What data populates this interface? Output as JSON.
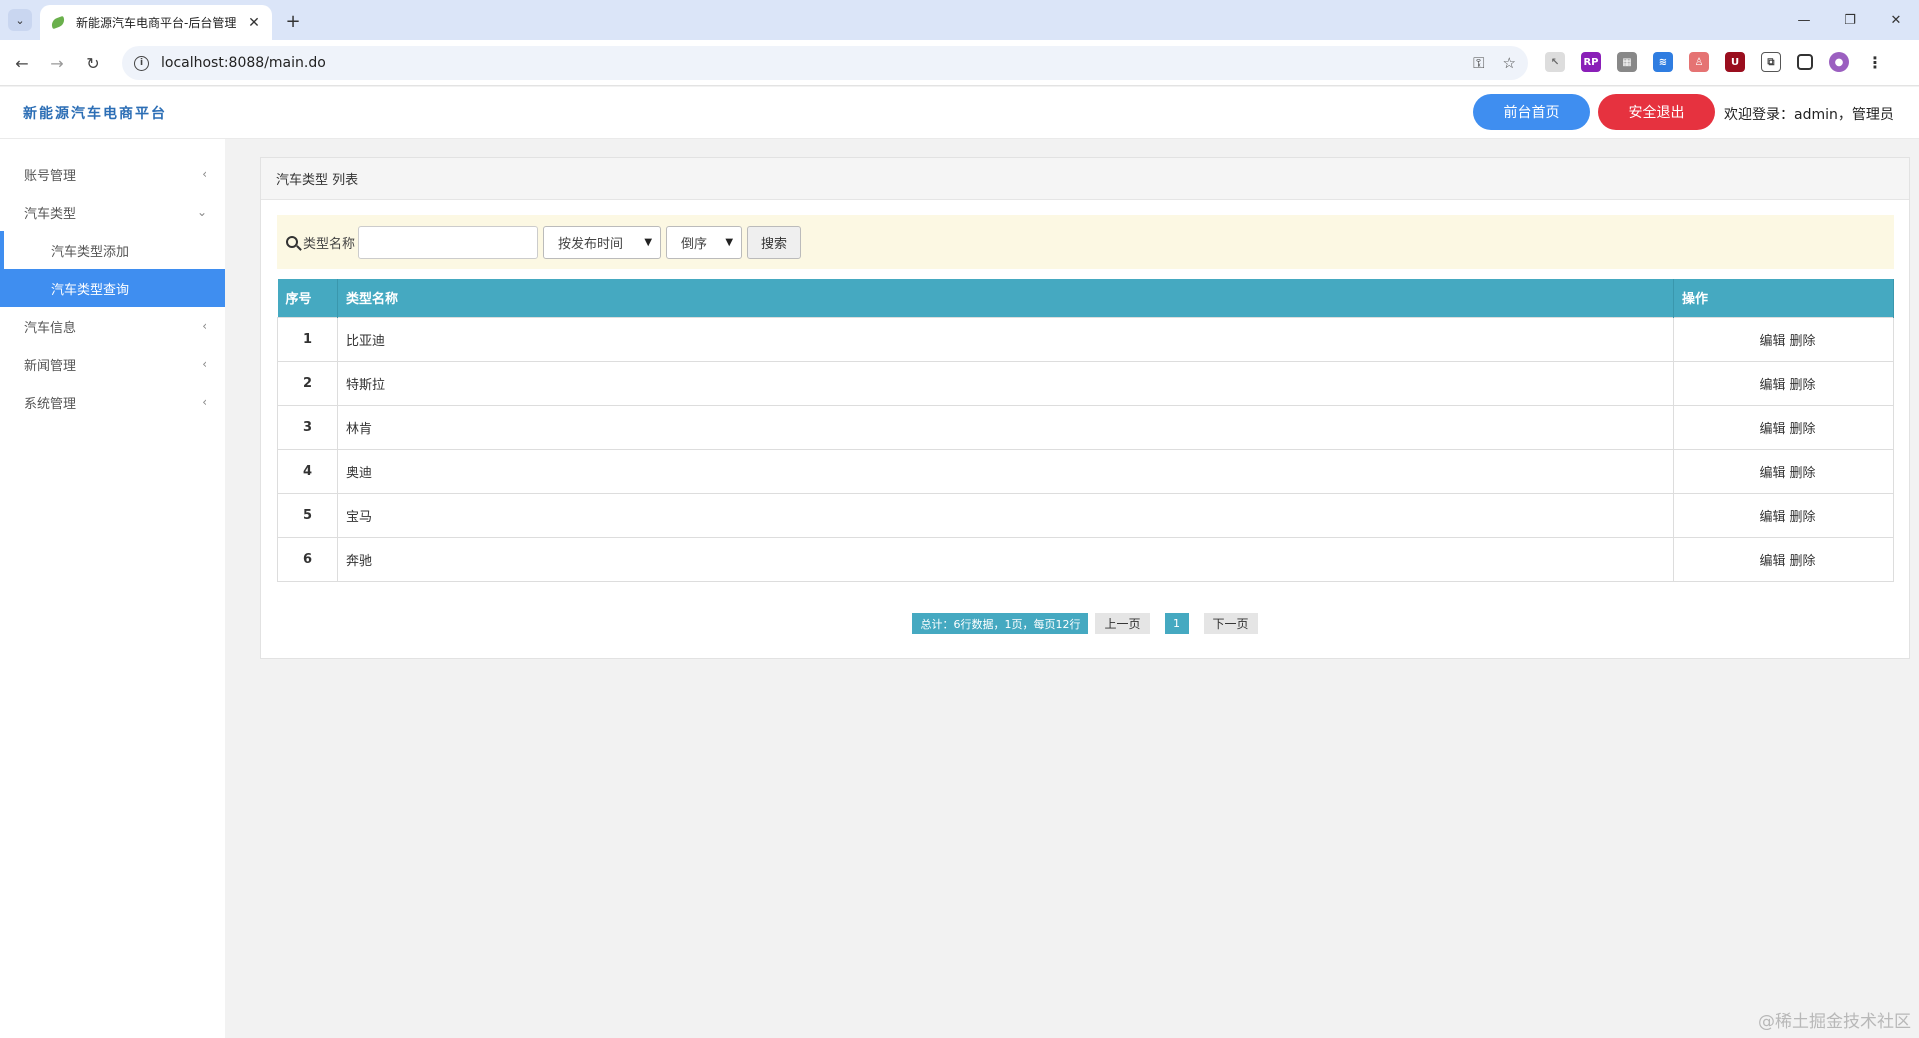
{
  "browser": {
    "tab_title": "新能源汽车电商平台-后台管理",
    "url": "localhost:8088/main.do"
  },
  "header": {
    "logo": "新能源汽车电商平台",
    "home_label": "前台首页",
    "logout_label": "安全退出",
    "welcome": "欢迎登录：admin，管理员"
  },
  "sidebar": {
    "items": [
      {
        "label": "账号管理"
      },
      {
        "label": "汽车类型"
      },
      {
        "label": "汽车类型添加"
      },
      {
        "label": "汽车类型查询"
      },
      {
        "label": "汽车信息"
      },
      {
        "label": "新闻管理"
      },
      {
        "label": "系统管理"
      }
    ]
  },
  "main": {
    "panel_title": "汽车类型 列表",
    "search": {
      "label": "类型名称",
      "value": "",
      "sort_selected": "按发布时间",
      "order_selected": "倒序",
      "button": "搜索"
    },
    "table": {
      "headers": [
        "序号",
        "类型名称",
        "操作"
      ],
      "rows": [
        {
          "no": "1",
          "name": "比亚迪"
        },
        {
          "no": "2",
          "name": "特斯拉"
        },
        {
          "no": "3",
          "name": "林肯"
        },
        {
          "no": "4",
          "name": "奥迪"
        },
        {
          "no": "5",
          "name": "宝马"
        },
        {
          "no": "6",
          "name": "奔驰"
        }
      ],
      "edit_label": "编辑",
      "delete_label": "删除"
    },
    "pager": {
      "info": "总计：6行数据，1页，每页12行",
      "prev": "上一页",
      "current": "1",
      "next": "下一页"
    }
  },
  "watermark": "@稀土掘金技术社区"
}
